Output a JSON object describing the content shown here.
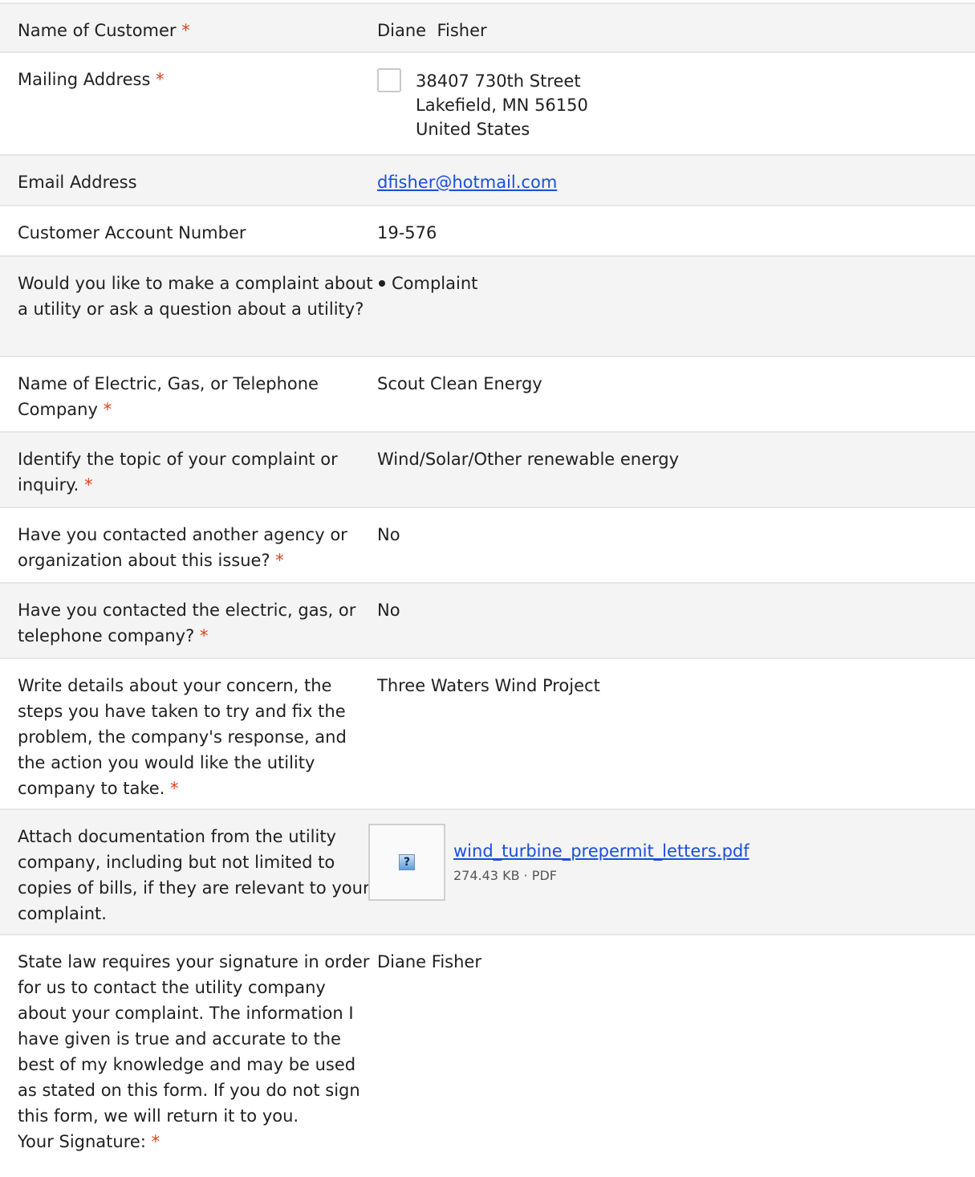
{
  "required_marker": "*",
  "rows": [
    {
      "label": "Name of Customer",
      "value": "Diane  Fisher"
    },
    {
      "label": "Mailing Address",
      "address_lines": [
        "38407 730th Street",
        "Lakefield, MN 56150",
        "United States"
      ]
    },
    {
      "label": "Email Address",
      "value": "dfisher@hotmail.com"
    },
    {
      "label": "Customer Account Number",
      "value": "19-576"
    },
    {
      "label": "Would you like to make a complaint about a utility or ask a question about a utility?",
      "value": "Complaint"
    },
    {
      "label": "Name of Electric, Gas, or Telephone Company",
      "value": "Scout Clean Energy"
    },
    {
      "label": "Identify the topic of your complaint or inquiry.",
      "value": "Wind/Solar/Other renewable energy"
    },
    {
      "label": "Have you contacted another agency or organization about this issue?",
      "value": "No"
    },
    {
      "label": "Have you contacted the electric, gas, or telephone company?",
      "value": "No"
    },
    {
      "label": "Write details about your concern, the steps you have taken to try and fix the problem, the company's response, and the action you would like the utility company to take.",
      "value": "Three Waters Wind Project"
    },
    {
      "label": "Attach documentation from the utility company, including but not limited to copies of bills, if they are relevant to your complaint.",
      "file_name": "wind_turbine_prepermit_letters.pdf",
      "file_meta": "274.43 KB · PDF",
      "thumb_glyph": "?"
    },
    {
      "label": "State law requires your signature in order for us to contact the utility company about your complaint. The information I have given is true and accurate to the best of my knowledge and may be used as stated on this form. If you do not sign this form, we will return it to you.",
      "label_line2": "Your Signature:",
      "value": "Diane Fisher"
    }
  ],
  "colors": {
    "required": "#e2401c",
    "link": "#1a4edc",
    "row_shade": "#f4f4f4",
    "divider": "#e6e6e6"
  },
  "icons": {
    "checkbox": "checkbox-icon",
    "bullet": "bullet-icon",
    "file_thumb": "question-file-icon"
  }
}
